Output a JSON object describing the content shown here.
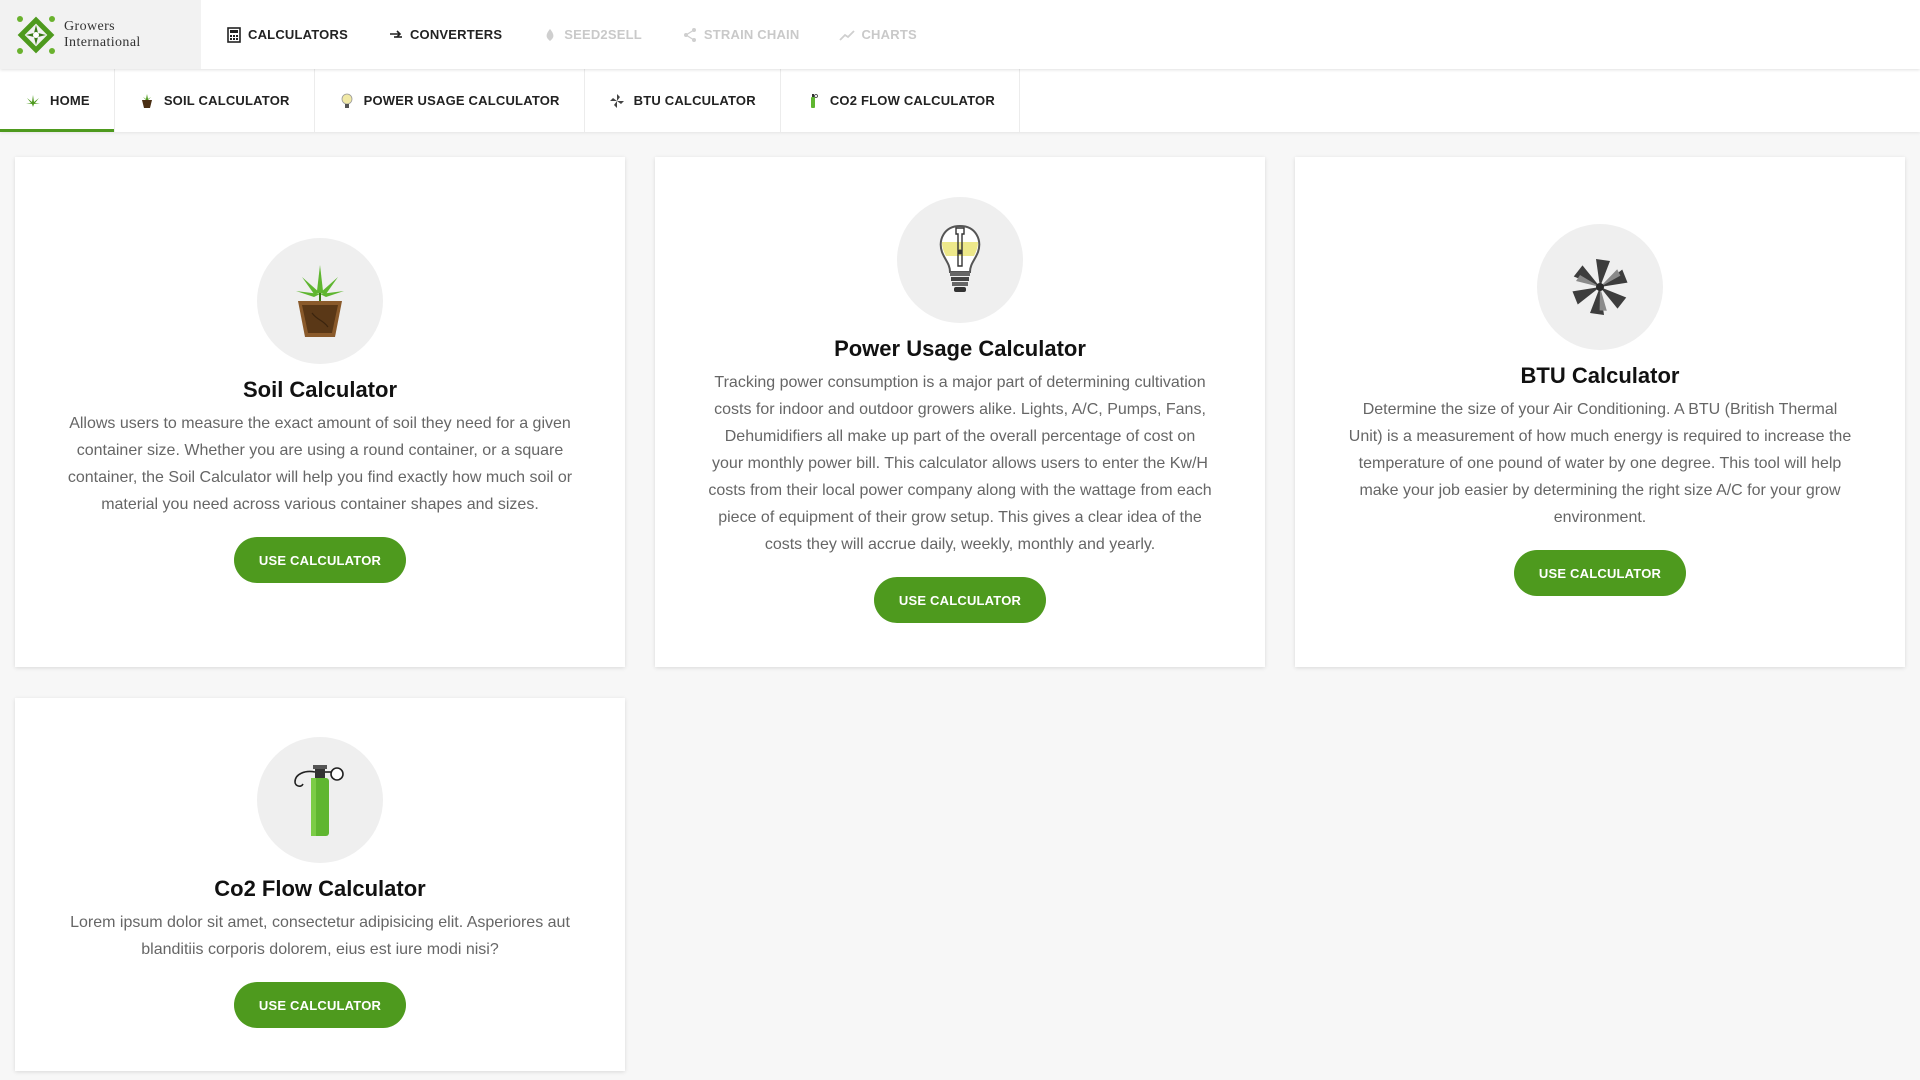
{
  "brand": {
    "line1": "Growers",
    "line2": "International",
    "color": "#4e9a1e"
  },
  "topnav": {
    "items": [
      {
        "label": "CALCULATORS",
        "icon": "calculator-icon",
        "enabled": true
      },
      {
        "label": "CONVERTERS",
        "icon": "convert-arrows-icon",
        "enabled": true
      },
      {
        "label": "SEED2SELL",
        "icon": "seed-icon",
        "enabled": false
      },
      {
        "label": "STRAIN CHAIN",
        "icon": "share-icon",
        "enabled": false
      },
      {
        "label": "CHARTS",
        "icon": "trend-line-icon",
        "enabled": false
      }
    ]
  },
  "tabs": {
    "active": "HOME",
    "items": [
      {
        "label": "HOME",
        "icon": "cannabis-leaf-icon"
      },
      {
        "label": "SOIL CALCULATOR",
        "icon": "plant-pot-icon"
      },
      {
        "label": "POWER USAGE CALCULATOR",
        "icon": "light-bulb-icon"
      },
      {
        "label": "BTU CALCULATOR",
        "icon": "fan-icon"
      },
      {
        "label": "CO2 FLOW CALCULATOR",
        "icon": "co2-tank-icon"
      }
    ]
  },
  "cards": {
    "soil": {
      "title": "Soil Calculator",
      "description": "Allows users to measure the exact amount of soil they need for a given container size. Whether you are using a round container, or a square container, the Soil Calculator will help you find exactly how much soil or material you need across various container shapes and sizes.",
      "button": "USE CALCULATOR",
      "icon": "plant-pot-icon"
    },
    "power": {
      "title": "Power Usage Calculator",
      "description": "Tracking power consumption is a major part of determining cultivation costs for indoor and outdoor growers alike. Lights, A/C, Pumps, Fans, Dehumidifiers all make up part of the overall percentage of cost on your monthly power bill. This calculator allows users to enter the Kw/H costs from their local power company along with the wattage from each piece of equipment of their grow setup. This gives a clear idea of the costs they will accrue daily, weekly, monthly and yearly.",
      "button": "USE CALCULATOR",
      "icon": "light-bulb-icon"
    },
    "btu": {
      "title": "BTU Calculator",
      "description": "Determine the size of your Air Conditioning. A BTU (British Thermal Unit) is a measurement of how much energy is required to increase the temperature of one pound of water by one degree. This tool will help make your job easier by determining the right size A/C for your grow environment.",
      "button": "USE CALCULATOR",
      "icon": "fan-icon"
    },
    "co2": {
      "title": "Co2 Flow Calculator",
      "description": "Lorem ipsum dolor sit amet, consectetur adipisicing elit. Asperiores aut blanditiis corporis dolorem, eius est iure modi nisi?",
      "button": "USE CALCULATOR",
      "icon": "co2-tank-icon"
    }
  }
}
